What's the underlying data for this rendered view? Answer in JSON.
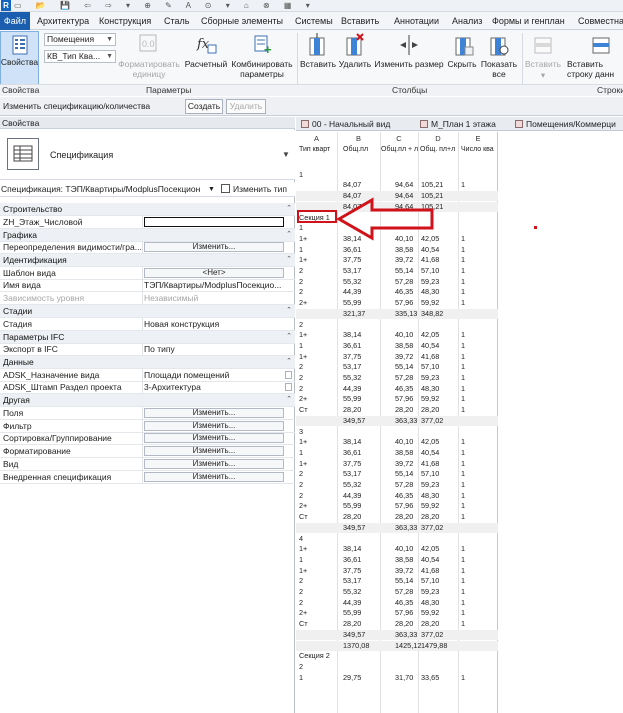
{
  "app": {
    "logo": "R",
    "quick_access": [
      "▭",
      "📂",
      "💾",
      "⇦",
      "⇨",
      "▾",
      "⊕",
      "✎",
      "A",
      "⊙",
      "▾",
      "⌂",
      "⊗",
      "▦",
      "▾"
    ]
  },
  "menu": [
    "Файл",
    "Архитектура",
    "Конструкция",
    "Сталь",
    "Сборные элементы",
    "Системы",
    "Вставить",
    "Аннотации",
    "Анализ",
    "Формы и генплан",
    "Совместная"
  ],
  "ribbon": {
    "properties_label": "Свойства",
    "combo1": "Помещения",
    "combo2": "КВ_Тип Ква...",
    "format_unit": "Форматировать\nединицу",
    "calculated": "Расчетный",
    "combined": "Комбинировать\nпараметры",
    "insert": "Вставить",
    "delete": "Удалить",
    "resize": "Изменить размер",
    "hide": "Скрыть",
    "show_all": "Показать\nвсе",
    "insert2": "Вставить",
    "insert_row": "Вставить\nстроку данн",
    "groups": {
      "properties": "Свойства",
      "parameters": "Параметры",
      "columns": "Столбцы",
      "rows": "Строки"
    }
  },
  "context": {
    "label": "Изменить спецификацию/количества",
    "create": "Создать",
    "delete": "Удалить"
  },
  "palette": {
    "title": "Свойства",
    "type_name": "Спецификация",
    "spec_selector": "Спецификация: ТЭП/Квартиры/ModplusПосекцион",
    "edit_type": "Изменить тип",
    "rows": [
      {
        "kind": "cat",
        "key": "Строительство"
      },
      {
        "kind": "box",
        "key": "ZH_Этаж_Числовой",
        "val": ""
      },
      {
        "kind": "cat",
        "key": "Графика"
      },
      {
        "kind": "btn",
        "key": "Переопределения видимости/гра...",
        "val": "Изменить..."
      },
      {
        "kind": "cat",
        "key": "Идентификация"
      },
      {
        "kind": "btn",
        "key": "Шаблон вида",
        "val": "<Нет>"
      },
      {
        "kind": "val",
        "key": "Имя вида",
        "val": "ТЭП/Квартиры/ModplusПосекцио..."
      },
      {
        "kind": "gray",
        "key": "Зависимость уровня",
        "val": "Независимый"
      },
      {
        "kind": "cat",
        "key": "Стадии"
      },
      {
        "kind": "val",
        "key": "Стадия",
        "val": "Новая конструкция"
      },
      {
        "kind": "cat",
        "key": "Параметры IFC"
      },
      {
        "kind": "val",
        "key": "Экспорт в IFC",
        "val": "По типу"
      },
      {
        "kind": "cat",
        "key": "Данные"
      },
      {
        "kind": "chk",
        "key": "ADSK_Назначение вида",
        "val": "Площади помещений"
      },
      {
        "kind": "chk",
        "key": "ADSK_Штамп Раздел проекта",
        "val": "3-Архитектура"
      },
      {
        "kind": "cat",
        "key": "Другая"
      },
      {
        "kind": "btn",
        "key": "Поля",
        "val": "Изменить..."
      },
      {
        "kind": "btn",
        "key": "Фильтр",
        "val": "Изменить..."
      },
      {
        "kind": "btn",
        "key": "Сортировка/Группирование",
        "val": "Изменить..."
      },
      {
        "kind": "btn",
        "key": "Форматирование",
        "val": "Изменить..."
      },
      {
        "kind": "btn",
        "key": "Вид",
        "val": "Изменить..."
      },
      {
        "kind": "btn",
        "key": "Внедренная спецификация",
        "val": "Изменить..."
      }
    ]
  },
  "tabs": [
    "00 - Начальный вид",
    "М_План 1 этажа",
    "Помещения/Коммерци"
  ],
  "schedule": {
    "letters": [
      "A",
      "B",
      "C",
      "D",
      "E"
    ],
    "headers": [
      "Тип кварт",
      "Общ.пл",
      "Общ.пл + л",
      "Общ. пл+л",
      "Число ква"
    ],
    "rows": [
      [
        "",
        "",
        "",
        "",
        ""
      ],
      [
        "1",
        "",
        "",
        "",
        ""
      ],
      [
        "",
        "84,07",
        "94,64",
        "105,21",
        "1"
      ],
      [
        "",
        "84,07",
        "94,64",
        "105,21",
        ""
      ],
      [
        "",
        "84,07",
        "94,64",
        "105,21",
        ""
      ],
      [
        "Секция 1",
        "",
        "",
        "",
        ""
      ],
      [
        "1",
        "",
        "",
        "",
        ""
      ],
      [
        "1+",
        "38,14",
        "40,10",
        "42,05",
        "1"
      ],
      [
        "1",
        "36,61",
        "38,58",
        "40,54",
        "1"
      ],
      [
        "1+",
        "37,75",
        "39,72",
        "41,68",
        "1"
      ],
      [
        "2",
        "53,17",
        "55,14",
        "57,10",
        "1"
      ],
      [
        "2",
        "55,32",
        "57,28",
        "59,23",
        "1"
      ],
      [
        "2",
        "44,39",
        "46,35",
        "48,30",
        "1"
      ],
      [
        "2+",
        "55,99",
        "57,96",
        "59,92",
        "1"
      ],
      [
        "",
        "321,37",
        "335,13",
        "348,82",
        ""
      ],
      [
        "2",
        "",
        "",
        "",
        ""
      ],
      [
        "1+",
        "38,14",
        "40,10",
        "42,05",
        "1"
      ],
      [
        "1",
        "36,61",
        "38,58",
        "40,54",
        "1"
      ],
      [
        "1+",
        "37,75",
        "39,72",
        "41,68",
        "1"
      ],
      [
        "2",
        "53,17",
        "55,14",
        "57,10",
        "1"
      ],
      [
        "2",
        "55,32",
        "57,28",
        "59,23",
        "1"
      ],
      [
        "2",
        "44,39",
        "46,35",
        "48,30",
        "1"
      ],
      [
        "2+",
        "55,99",
        "57,96",
        "59,92",
        "1"
      ],
      [
        "Ст",
        "28,20",
        "28,20",
        "28,20",
        "1"
      ],
      [
        "",
        "349,57",
        "363,33",
        "377,02",
        ""
      ],
      [
        "3",
        "",
        "",
        "",
        ""
      ],
      [
        "1+",
        "38,14",
        "40,10",
        "42,05",
        "1"
      ],
      [
        "1",
        "36,61",
        "38,58",
        "40,54",
        "1"
      ],
      [
        "1+",
        "37,75",
        "39,72",
        "41,68",
        "1"
      ],
      [
        "2",
        "53,17",
        "55,14",
        "57,10",
        "1"
      ],
      [
        "2",
        "55,32",
        "57,28",
        "59,23",
        "1"
      ],
      [
        "2",
        "44,39",
        "46,35",
        "48,30",
        "1"
      ],
      [
        "2+",
        "55,99",
        "57,96",
        "59,92",
        "1"
      ],
      [
        "Ст",
        "28,20",
        "28,20",
        "28,20",
        "1"
      ],
      [
        "",
        "349,57",
        "363,33",
        "377,02",
        ""
      ],
      [
        "4",
        "",
        "",
        "",
        ""
      ],
      [
        "1+",
        "38,14",
        "40,10",
        "42,05",
        "1"
      ],
      [
        "1",
        "36,61",
        "38,58",
        "40,54",
        "1"
      ],
      [
        "1+",
        "37,75",
        "39,72",
        "41,68",
        "1"
      ],
      [
        "2",
        "53,17",
        "55,14",
        "57,10",
        "1"
      ],
      [
        "2",
        "55,32",
        "57,28",
        "59,23",
        "1"
      ],
      [
        "2",
        "44,39",
        "46,35",
        "48,30",
        "1"
      ],
      [
        "2+",
        "55,99",
        "57,96",
        "59,92",
        "1"
      ],
      [
        "Ст",
        "28,20",
        "28,20",
        "28,20",
        "1"
      ],
      [
        "",
        "349,57",
        "363,33",
        "377,02",
        ""
      ],
      [
        "",
        "1370,08",
        "1425,12",
        "1479,88",
        ""
      ],
      [
        "Секция 2",
        "",
        "",
        "",
        ""
      ],
      [
        "2",
        "",
        "",
        "",
        ""
      ],
      [
        "1",
        "29,75",
        "31,70",
        "33,65",
        "1"
      ]
    ]
  },
  "annotation": {
    "color": "#d0121b"
  },
  "colors": {
    "accent": "#1b5eb0"
  }
}
